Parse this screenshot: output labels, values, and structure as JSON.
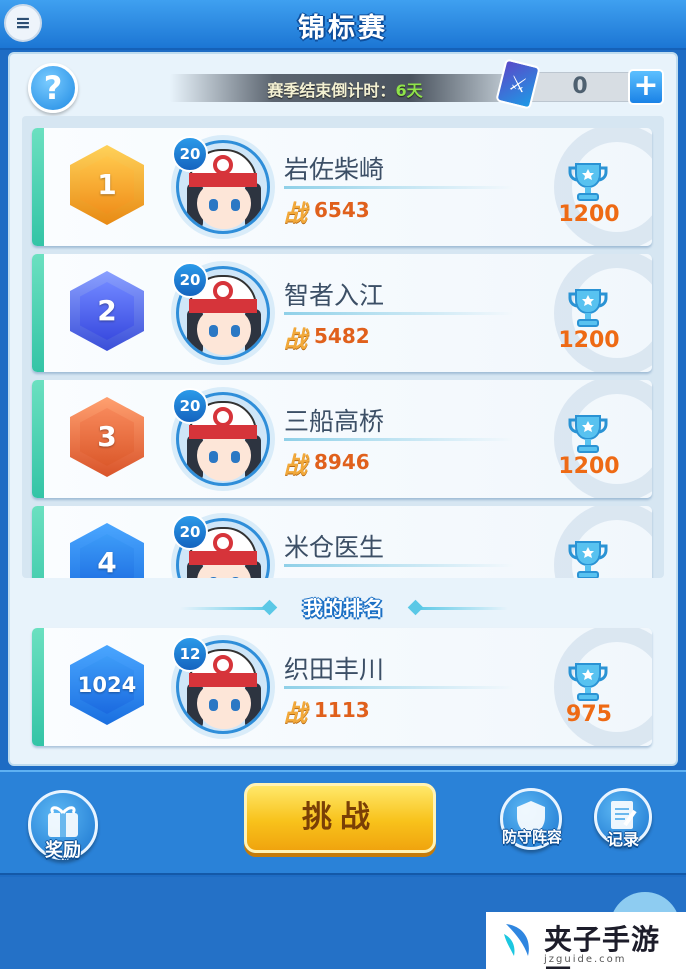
{
  "header": {
    "title": "锦标赛",
    "menu_glyph": "≡"
  },
  "season": {
    "label": "赛季结束倒计时：",
    "days": "6天",
    "ticket_count": "0",
    "add_glyph": "+",
    "help_glyph": "?"
  },
  "leaderboard": [
    {
      "rank": "1",
      "level": "20",
      "name": "岩佐柴崎",
      "power": "6543",
      "trophies": "1200"
    },
    {
      "rank": "2",
      "level": "20",
      "name": "智者入江",
      "power": "5482",
      "trophies": "1200"
    },
    {
      "rank": "3",
      "level": "20",
      "name": "三船高桥",
      "power": "8946",
      "trophies": "1200"
    },
    {
      "rank": "4",
      "level": "20",
      "name": "米仓医生",
      "power": "",
      "trophies": ""
    }
  ],
  "my_rank": {
    "title": "我的排名",
    "rank": "1024",
    "level": "12",
    "name": "织田丰川",
    "power": "1113",
    "trophies": "975"
  },
  "power_glyph": "战",
  "buttons": {
    "rewards": "奖励",
    "challenge": "挑战",
    "defense": "防守阵容",
    "records": "记录"
  },
  "watermark": {
    "text": "夹子手游网",
    "url": "jzguide.com"
  },
  "colors": {
    "gold": "#f6b21f",
    "silver_blue": "#5a6cf0",
    "bronze": "#f0703c",
    "blue": "#1f86e8",
    "score_orange": "#ee6a14"
  }
}
